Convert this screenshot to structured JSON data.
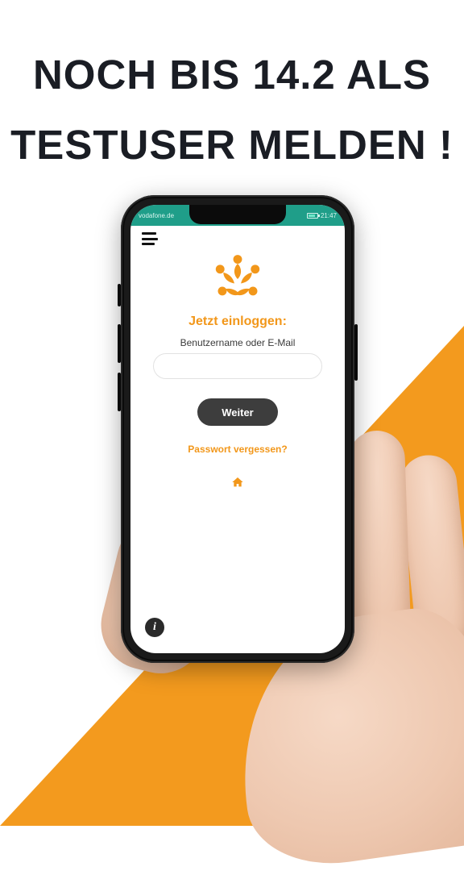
{
  "headline": {
    "line1": "Noch bis 14.2 als",
    "line2": "Testuser melden !"
  },
  "status": {
    "carrier": "vodafone.de",
    "time": "21:47"
  },
  "login": {
    "title": "Jetzt einloggen:",
    "field_label": "Benutzername oder E-Mail",
    "input_value": "",
    "continue_label": "Weiter",
    "forgot_label": "Passwort vergessen?"
  },
  "icons": {
    "hamburger": "menu-icon",
    "home": "home-icon",
    "info": "i"
  },
  "colors": {
    "accent": "#f2971a",
    "statusbar": "#1f9e89",
    "dark": "#1a1d24"
  }
}
